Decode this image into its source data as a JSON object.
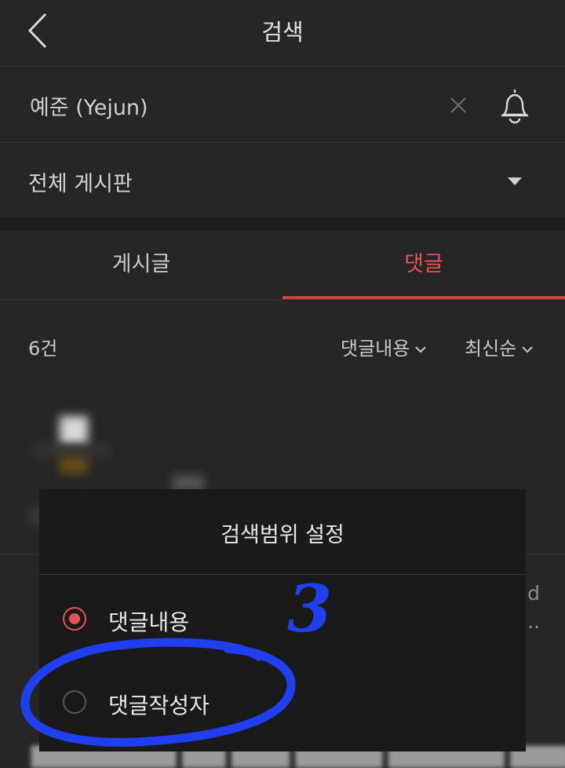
{
  "header": {
    "title": "검색"
  },
  "search": {
    "query": "예준 (Yejun)"
  },
  "board_filter": {
    "selected": "전체 게시판"
  },
  "tabs": [
    {
      "label": "게시글",
      "active": false
    },
    {
      "label": "댓글",
      "active": true
    }
  ],
  "results": {
    "count": "6건",
    "scope_sort": "댓글내용",
    "order_sort": "최신순"
  },
  "background_fragments": {
    "right_text": "nd",
    "ellipsis": "..."
  },
  "modal": {
    "title": "검색범위 설정",
    "options": [
      {
        "label": "댓글내용",
        "selected": true
      },
      {
        "label": "댓글작성자",
        "selected": false
      }
    ]
  },
  "annotation": {
    "number": "3",
    "color": "#1f3ff0"
  },
  "colors": {
    "accent": "#e4534f",
    "background": "#262626",
    "modal_background": "#1a1a1a"
  }
}
